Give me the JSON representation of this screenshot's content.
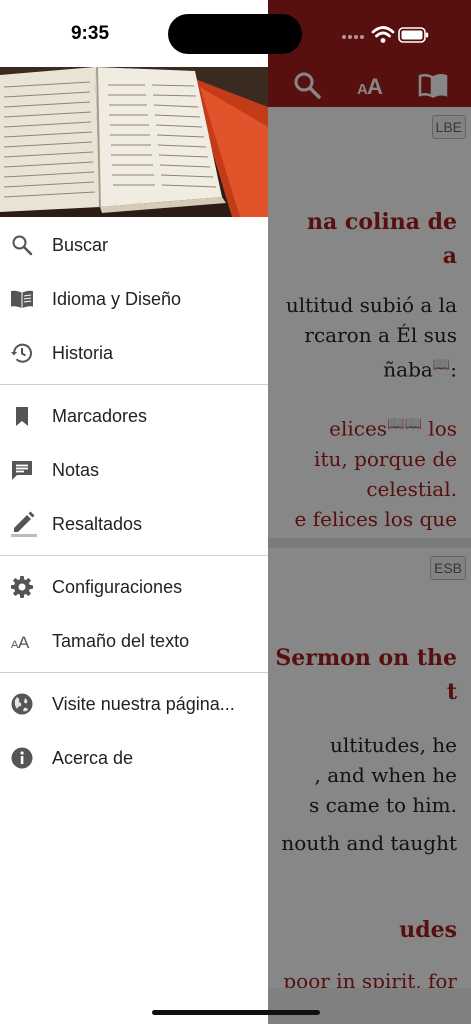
{
  "status_bar": {
    "time": "9:35"
  },
  "app": {
    "header": {
      "icons": [
        "search-icon",
        "text-size-icon",
        "book-icon"
      ],
      "color": "#a41d1d"
    },
    "panes": [
      {
        "version": "LBE",
        "title_lines": [
          "na colina de",
          "a"
        ],
        "text_lines": [
          "ultitud subió a la",
          "rcaron a Él sus",
          "ñaba"
        ],
        "red_lines": [
          "elices",
          "itu, porque de",
          "celestial.",
          "e felices los que"
        ]
      },
      {
        "version": "ESB",
        "title_lines": [
          "Sermon on the",
          "t"
        ],
        "text_lines": [
          "ultitudes, he",
          ", and when he",
          "s came to him.",
          "nouth and taught"
        ],
        "title2": "udes",
        "tail": "poor in spirit, for"
      }
    ]
  },
  "drawer": {
    "menu_groups": [
      [
        {
          "icon": "search-icon",
          "label": "Buscar"
        },
        {
          "icon": "book-open-icon",
          "label": "Idioma y Diseño"
        },
        {
          "icon": "history-icon",
          "label": "Historia"
        }
      ],
      [
        {
          "icon": "bookmark-icon",
          "label": "Marcadores"
        },
        {
          "icon": "notes-icon",
          "label": "Notas"
        },
        {
          "icon": "pencil-highlight-icon",
          "label": "Resaltados"
        }
      ],
      [
        {
          "icon": "gear-icon",
          "label": "Configuraciones"
        },
        {
          "icon": "text-size-icon",
          "label": "Tamaño del texto"
        }
      ],
      [
        {
          "icon": "globe-icon",
          "label": "Visite nuestra página..."
        },
        {
          "icon": "info-icon",
          "label": "Acerca de"
        }
      ]
    ]
  }
}
